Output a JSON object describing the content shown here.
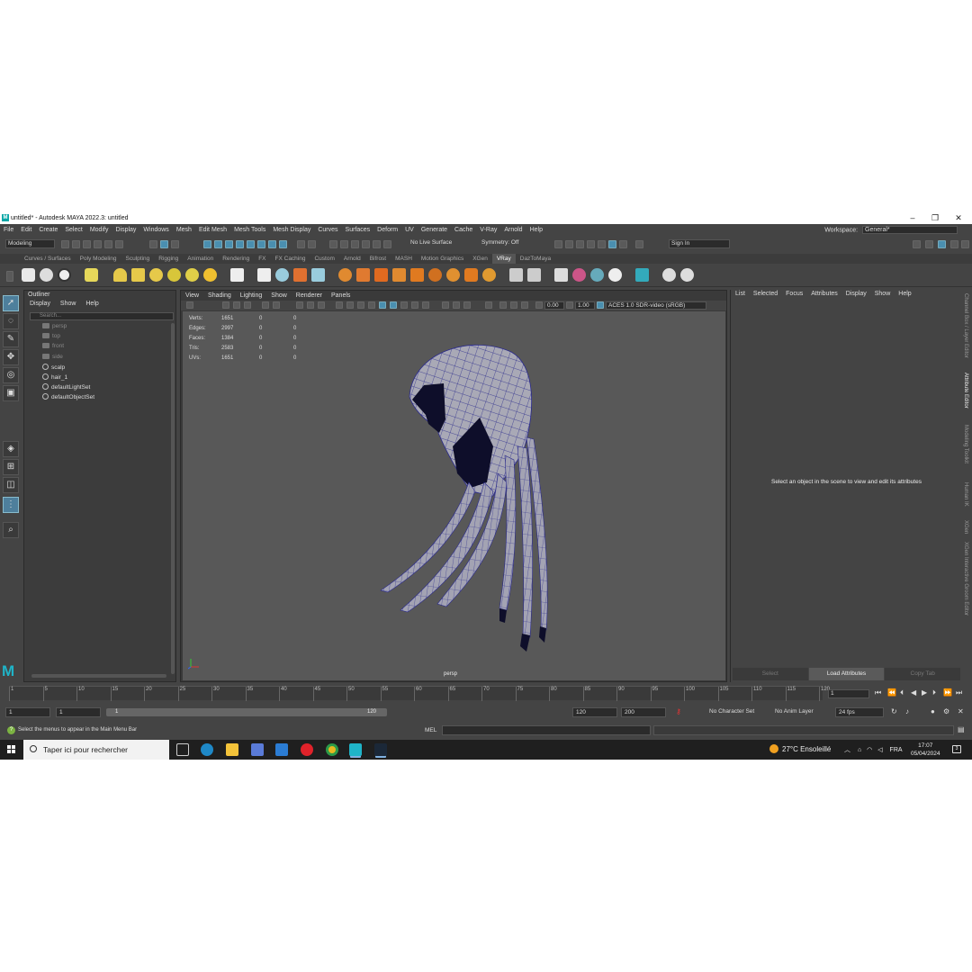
{
  "window": {
    "title": "untitled* - Autodesk MAYA 2022.3: untitled"
  },
  "menubar": {
    "items": [
      "File",
      "Edit",
      "Create",
      "Select",
      "Modify",
      "Display",
      "Windows",
      "Mesh",
      "Edit Mesh",
      "Mesh Tools",
      "Mesh Display",
      "Curves",
      "Surfaces",
      "Deform",
      "UV",
      "Generate",
      "Cache",
      "V-Ray",
      "Arnold",
      "Help"
    ],
    "workspace_label": "Workspace:",
    "workspace_value": "General*"
  },
  "statusline": {
    "menuset": "Modeling",
    "live_surface": "No Live Surface",
    "symmetry": "Symmetry: Off",
    "sign_in": "Sign In"
  },
  "shelf": {
    "tabs": [
      "Curves / Surfaces",
      "Poly Modeling",
      "Sculpting",
      "Rigging",
      "Animation",
      "Rendering",
      "FX",
      "FX Caching",
      "Custom",
      "Arnold",
      "Bifrost",
      "MASH",
      "Motion Graphics",
      "XGen",
      "VRay",
      "DazToMaya"
    ],
    "active_tab": "VRay"
  },
  "outliner": {
    "title": "Outliner",
    "menus": [
      "Display",
      "Show",
      "Help"
    ],
    "search_placeholder": "Search...",
    "items": [
      {
        "label": "persp",
        "type": "camera",
        "dim": true
      },
      {
        "label": "top",
        "type": "camera",
        "dim": true
      },
      {
        "label": "front",
        "type": "camera",
        "dim": true
      },
      {
        "label": "side",
        "type": "camera",
        "dim": true
      },
      {
        "label": "scalp",
        "type": "mesh",
        "dim": false
      },
      {
        "label": "hair_1",
        "type": "mesh",
        "dim": false
      },
      {
        "label": "defaultLightSet",
        "type": "set",
        "dim": false
      },
      {
        "label": "defaultObjectSet",
        "type": "set",
        "dim": false
      }
    ]
  },
  "viewport": {
    "menus": [
      "View",
      "Shading",
      "Lighting",
      "Show",
      "Renderer",
      "Panels"
    ],
    "exposure": "0.00",
    "gamma": "1.00",
    "color_space": "ACES 1.0 SDR-video (sRGB)",
    "camera_label": "persp",
    "hud": [
      {
        "label": "Verts:",
        "value": "1651",
        "sel": "0",
        "comp": "0"
      },
      {
        "label": "Edges:",
        "value": "2997",
        "sel": "0",
        "comp": "0"
      },
      {
        "label": "Faces:",
        "value": "1384",
        "sel": "0",
        "comp": "0"
      },
      {
        "label": "Tris:",
        "value": "2583",
        "sel": "0",
        "comp": "0"
      },
      {
        "label": "UVs:",
        "value": "1651",
        "sel": "0",
        "comp": "0"
      }
    ]
  },
  "attribute_editor": {
    "menus": [
      "List",
      "Selected",
      "Focus",
      "Attributes",
      "Display",
      "Show",
      "Help"
    ],
    "message": "Select an object in the scene to view and edit its attributes",
    "buttons": [
      "Select",
      "Load Attributes",
      "Copy Tab"
    ],
    "side_tabs": [
      "Channel Box / Layer Editor",
      "Attribute Editor",
      "Modeling Toolkit",
      "Human IK",
      "XGen",
      "XGen Interactive Groom Editor"
    ]
  },
  "timeline": {
    "ticks": [
      "1",
      "5",
      "10",
      "15",
      "20",
      "25",
      "30",
      "35",
      "40",
      "45",
      "50",
      "55",
      "60",
      "65",
      "70",
      "75",
      "80",
      "85",
      "90",
      "95",
      "100",
      "105",
      "110",
      "115",
      "120"
    ],
    "current_frame": "1"
  },
  "range": {
    "start": "1",
    "playback_start": "1",
    "slider_start": "1",
    "slider_end": "120",
    "playback_end": "120",
    "end": "200",
    "character_set": "No Character Set",
    "anim_layer": "No Anim Layer",
    "fps": "24 fps"
  },
  "helpline": {
    "text": "Select the menus to appear in the Main Menu Bar",
    "mel_label": "MEL"
  },
  "taskbar": {
    "search_placeholder": "Taper ici pour rechercher",
    "weather": "27°C  Ensoleillé",
    "language": "FRA",
    "time": "17:07",
    "date": "05/04/2024",
    "notification_count": "3"
  },
  "colors": {
    "accent": "#4a8fb0",
    "maya_logo": "#1fb4c8",
    "wireframe": "#2a2a8c",
    "mesh_fill": "#a9a9b6"
  }
}
